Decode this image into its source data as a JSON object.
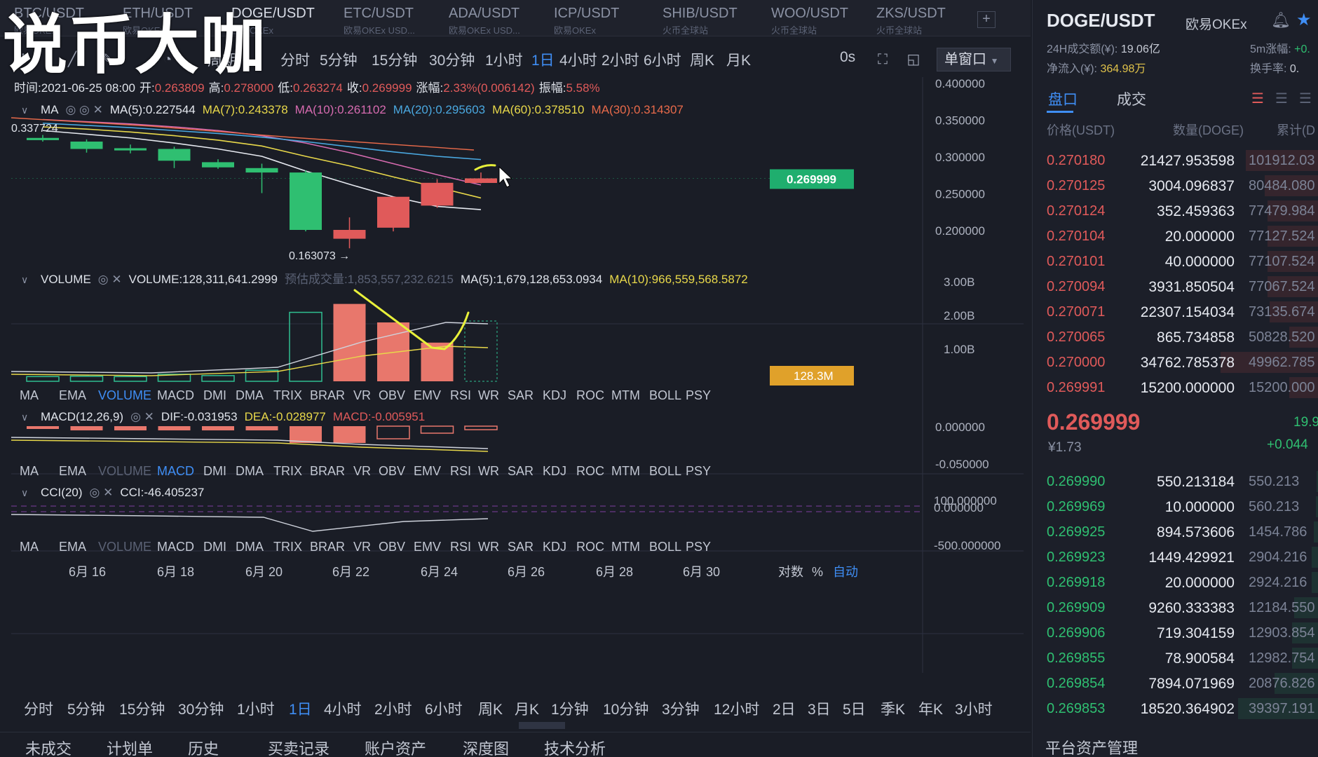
{
  "watermark": "说币大咖",
  "tabs": [
    {
      "pair": "BTC/USDT",
      "exchange": "欧易OKEx"
    },
    {
      "pair": "ETH/USDT",
      "exchange": "欧易OKEx"
    },
    {
      "pair": "DOGE/USDT",
      "exchange": "欧易OKEx"
    },
    {
      "pair": "ETC/USDT",
      "exchange": "欧易OKEx USD..."
    },
    {
      "pair": "ADA/USDT",
      "exchange": "欧易OKEx USD..."
    },
    {
      "pair": "ICP/USDT",
      "exchange": "欧易OKEx"
    },
    {
      "pair": "SHIB/USDT",
      "exchange": "火币全球站"
    },
    {
      "pair": "WOO/USDT",
      "exchange": "火币全球站"
    },
    {
      "pair": "ZKS/USDT",
      "exchange": "火币全球站"
    }
  ],
  "tab_add": "+",
  "toolbar": {
    "period_label": "周期",
    "periods": [
      "分时",
      "5分钟",
      "15分钟",
      "30分钟",
      "1小时",
      "1日",
      "4小时",
      "2小时",
      "6小时",
      "周K",
      "月K"
    ],
    "active_period": "1日",
    "countdown": "0s",
    "window_mode": "单窗口"
  },
  "ohlc_bar": {
    "time_label": "时间:",
    "time": "2021-06-25 08:00",
    "open_label": "开:",
    "open": "0.263809",
    "high_label": "高:",
    "high": "0.278000",
    "low_label": "低:",
    "low": "0.263274",
    "close_label": "收:",
    "close": "0.269999",
    "change_label": "涨幅:",
    "change": "2.33%(0.006142)",
    "amp_label": "振幅:",
    "amp": "5.58%"
  },
  "ma_legend": {
    "name": "MA",
    "items": [
      {
        "label": "MA(5):0.227544",
        "color": "#e6e9f0"
      },
      {
        "label": "MA(7):0.243378",
        "color": "#e8d84a"
      },
      {
        "label": "MA(10):0.261102",
        "color": "#d76bb0"
      },
      {
        "label": "MA(20):0.295603",
        "color": "#4aa8e0"
      },
      {
        "label": "MA(60):0.378510",
        "color": "#e8d84a"
      },
      {
        "label": "MA(30):0.314307",
        "color": "#e86a4a"
      }
    ]
  },
  "volume_legend": {
    "name": "VOLUME",
    "value": "VOLUME:128,311,641.2999",
    "estimate": "预估成交量:1,853,557,232.6215",
    "ma5": "MA(5):1,679,128,653.0934",
    "ma10": "MA(10):966,559,568.5872"
  },
  "macd_legend": {
    "name": "MACD(12,26,9)",
    "dif": "DIF:-0.031953",
    "dea": "DEA:-0.028977",
    "macd": "MACD:-0.005951"
  },
  "cci_legend": {
    "name": "CCI(20)",
    "value": "CCI:-46.405237"
  },
  "indicator_tabs": [
    "MA",
    "EMA",
    "VOLUME",
    "MACD",
    "DMI",
    "DMA",
    "TRIX",
    "BRAR",
    "VR",
    "OBV",
    "EMV",
    "RSI",
    "WR",
    "SAR",
    "KDJ",
    "ROC",
    "MTM",
    "BOLL",
    "PSY"
  ],
  "price_axis": [
    "0.400000",
    "0.350000",
    "0.300000",
    "0.250000",
    "0.200000"
  ],
  "price_current": "0.269999",
  "price_max_label": "0.337724",
  "price_min_label": "0.163073 →",
  "volume_axis": [
    "3.00B",
    "2.00B",
    "1.00B"
  ],
  "volume_current": "128.3M",
  "macd_axis": [
    "0.000000",
    "-0.050000"
  ],
  "cci_axis": [
    "100.000000",
    "0.000000",
    "-500.000000"
  ],
  "date_axis": [
    "6月 16",
    "6月 18",
    "6月 20",
    "6月 22",
    "6月 24",
    "6月 26",
    "6月 28",
    "6月 30"
  ],
  "axis_options": {
    "log": "对数",
    "percent": "%",
    "auto": "自动"
  },
  "bottom_periods": [
    "分时",
    "5分钟",
    "15分钟",
    "30分钟",
    "1小时",
    "1日",
    "4小时",
    "2小时",
    "6小时",
    "周K",
    "月K",
    "1分钟",
    "10分钟",
    "3分钟",
    "12小时",
    "2日",
    "3日",
    "5日",
    "季K",
    "年K",
    "3小时"
  ],
  "bottom_tabs": [
    "未成交",
    "计划单",
    "历史",
    "买卖记录",
    "账户资产",
    "深度图",
    "技术分析"
  ],
  "colors": {
    "up": "#e05a5a",
    "down": "#2fbf71",
    "accent": "#3f8ef5",
    "annotation": "#e8f03a"
  },
  "right_panel": {
    "pair": "DOGE/USDT",
    "exchange": "欧易OKEx",
    "vol24_label": "24H成交额(¥):",
    "vol24": "19.06亿",
    "inflow_label": "净流入(¥):",
    "inflow": "364.98万",
    "m5_label": "5m涨幅:",
    "m5": "+0.",
    "turnover_label": "换手率:",
    "turnover": "0.",
    "tab_book": "盘口",
    "tab_trades": "成交",
    "head_price": "价格(USDT)",
    "head_qty": "数量(DOGE)",
    "head_cum": "累计(D",
    "asks": [
      {
        "price": "0.270180",
        "qty": "21427.953598",
        "cum": "101912.03",
        "depth": 0.74
      },
      {
        "price": "0.270125",
        "qty": "3004.096837",
        "cum": "80484.080",
        "depth": 0.55
      },
      {
        "price": "0.270124",
        "qty": "352.459363",
        "cum": "77479.984",
        "depth": 0.52
      },
      {
        "price": "0.270104",
        "qty": "20.000000",
        "cum": "77127.524",
        "depth": 0.52
      },
      {
        "price": "0.270101",
        "qty": "40.000000",
        "cum": "77107.524",
        "depth": 0.52
      },
      {
        "price": "0.270094",
        "qty": "3931.850504",
        "cum": "77067.524",
        "depth": 0.52
      },
      {
        "price": "0.270071",
        "qty": "22307.154034",
        "cum": "73135.674",
        "depth": 0.5
      },
      {
        "price": "0.270065",
        "qty": "865.734858",
        "cum": "50828.520",
        "depth": 0.3
      },
      {
        "price": "0.270000",
        "qty": "34762.785378",
        "cum": "49962.785",
        "depth": 1.0
      },
      {
        "price": "0.269991",
        "qty": "15200.000000",
        "cum": "15200.000",
        "depth": 0.3
      }
    ],
    "last_price": "0.269999",
    "last_cny": "¥1.73",
    "last_right1": "19.9",
    "last_right2": "+0.044",
    "bids": [
      {
        "price": "0.269990",
        "qty": "550.213184",
        "cum": "550.213",
        "depth": 0.02
      },
      {
        "price": "0.269969",
        "qty": "10.000000",
        "cum": "560.213",
        "depth": 0.03
      },
      {
        "price": "0.269925",
        "qty": "894.573606",
        "cum": "1454.786",
        "depth": 0.05
      },
      {
        "price": "0.269923",
        "qty": "1449.429921",
        "cum": "2904.216",
        "depth": 0.07
      },
      {
        "price": "0.269918",
        "qty": "20.000000",
        "cum": "2924.216",
        "depth": 0.07
      },
      {
        "price": "0.269909",
        "qty": "9260.333383",
        "cum": "12184.550",
        "depth": 0.25
      },
      {
        "price": "0.269906",
        "qty": "719.304159",
        "cum": "12903.854",
        "depth": 0.27
      },
      {
        "price": "0.269855",
        "qty": "78.900584",
        "cum": "12982.754",
        "depth": 0.27
      },
      {
        "price": "0.269854",
        "qty": "7894.071969",
        "cum": "20876.826",
        "depth": 0.45
      },
      {
        "price": "0.269853",
        "qty": "18520.364902",
        "cum": "39397.191",
        "depth": 0.82
      }
    ],
    "footer": "平台资产管理"
  },
  "chart_data": {
    "type": "candlestick",
    "candles": [
      {
        "date": "6月 15",
        "open": 0.325,
        "high": 0.329,
        "low": 0.32,
        "close": 0.322
      },
      {
        "date": "6月 16",
        "open": 0.32,
        "high": 0.323,
        "low": 0.305,
        "close": 0.31
      },
      {
        "date": "6月 17",
        "open": 0.311,
        "high": 0.316,
        "low": 0.304,
        "close": 0.308
      },
      {
        "date": "6月 18",
        "open": 0.31,
        "high": 0.313,
        "low": 0.284,
        "close": 0.294
      },
      {
        "date": "6月 19",
        "open": 0.292,
        "high": 0.296,
        "low": 0.283,
        "close": 0.285
      },
      {
        "date": "6月 20",
        "open": 0.284,
        "high": 0.29,
        "low": 0.25,
        "close": 0.278
      },
      {
        "date": "6月 21",
        "open": 0.278,
        "high": 0.281,
        "low": 0.198,
        "close": 0.2
      },
      {
        "date": "6月 22",
        "open": 0.188,
        "high": 0.217,
        "low": 0.175,
        "close": 0.2
      },
      {
        "date": "6月 23",
        "open": 0.203,
        "high": 0.245,
        "low": 0.198,
        "close": 0.245
      },
      {
        "date": "6月 24",
        "open": 0.233,
        "high": 0.269,
        "low": 0.23,
        "close": 0.264
      },
      {
        "date": "6月 25",
        "open": 0.263809,
        "high": 0.278,
        "low": 0.263274,
        "close": 0.269999
      }
    ],
    "volume": [
      140,
      150,
      140,
      210,
      170,
      330,
      2050,
      2300,
      1750,
      1150,
      128.3
    ],
    "ma": {
      "MA5": [
        0.335,
        0.33,
        0.325,
        0.318,
        0.31,
        0.3,
        0.28,
        0.262,
        0.245,
        0.232,
        0.227544
      ],
      "MA7": [
        0.34,
        0.337,
        0.333,
        0.328,
        0.322,
        0.314,
        0.3,
        0.287,
        0.272,
        0.258,
        0.243378
      ],
      "MA10": [
        0.35,
        0.347,
        0.344,
        0.34,
        0.335,
        0.328,
        0.318,
        0.305,
        0.29,
        0.275,
        0.261102
      ],
      "MA20": [
        0.345,
        0.342,
        0.339,
        0.335,
        0.331,
        0.326,
        0.32,
        0.313,
        0.306,
        0.3,
        0.295603
      ]
    },
    "price_range": [
      0.15,
      0.42
    ],
    "volume_range": [
      0,
      3200
    ]
  }
}
